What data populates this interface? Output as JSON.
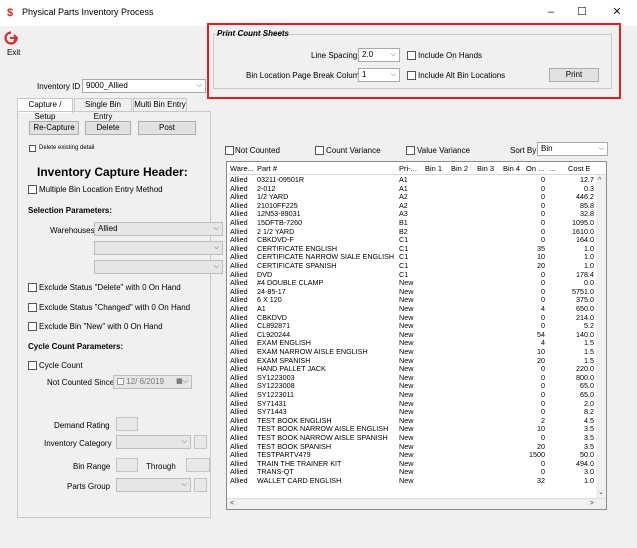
{
  "window": {
    "title": "Physical Parts Inventory Process",
    "minimize": "–",
    "maximize": "☐",
    "close": "✕"
  },
  "toolbar": {
    "exit_label": "Exit"
  },
  "inventory": {
    "label": "Inventory ID",
    "value": "9000_Allied"
  },
  "print_count_sheets": {
    "title": "Print Count Sheets",
    "line_spacing_label": "Line Spacing",
    "line_spacing_value": "2.0",
    "include_on_hands": "Include On Hands",
    "bin_break_label": "Bin Location Page Break Column",
    "bin_break_value": "1",
    "include_alt_bins": "Include Alt Bin Locations",
    "print_button": "Print"
  },
  "tabs": [
    "Capture / Setup",
    "Single Bin Entry",
    "Multi Bin Entry"
  ],
  "actions": {
    "recapture": "Re-Capture",
    "delete": "Delete",
    "post": "Post"
  },
  "capture": {
    "delete_existing": "Delete existing detail",
    "header_title": "Inventory Capture Header:",
    "multi_bin": "Multiple Bin Location Entry Method",
    "selection_params": "Selection Parameters:",
    "warehouses_label": "Warehouses",
    "warehouses_value": "Allied",
    "exclude_delete": "Exclude Status \"Delete\" with 0 On Hand",
    "exclude_changed": "Exclude Status \"Changed\" with 0 On Hand",
    "exclude_new": "Exclude Bin \"New\" with 0 On Hand",
    "cycle_params": "Cycle Count Parameters:",
    "cycle_count": "Cycle Count",
    "not_counted_since": "Not Counted Since",
    "date_value": "12/ 6/2019",
    "demand_rating": "Demand Rating",
    "inventory_category": "Inventory Category",
    "bin_range": "Bin Range",
    "through": "Through",
    "parts_group": "Parts Group"
  },
  "filters": {
    "not_counted": "Not Counted",
    "count_variance": "Count Variance",
    "value_variance": "Value Variance",
    "sort_by_label": "Sort By",
    "sort_by_value": "Bin"
  },
  "grid": {
    "columns": [
      "Ware...",
      "Part #",
      "Pri-...",
      "Bin 1",
      "Bin 2",
      "Bin 3",
      "Bin 4",
      "On ...",
      "...",
      "Cost E"
    ],
    "rows": [
      [
        "Allied",
        "03211-09501R",
        "A1",
        "0",
        "12.7"
      ],
      [
        "Allied",
        "2-012",
        "A1",
        "0",
        "0.3"
      ],
      [
        "Allied",
        "1/2 YARD",
        "A2",
        "0",
        "446.2"
      ],
      [
        "Allied",
        "21010FF225",
        "A2",
        "0",
        "85.8"
      ],
      [
        "Allied",
        "12N53-89031",
        "A3",
        "0",
        "32.8"
      ],
      [
        "Allied",
        "15DFTB-7260",
        "B1",
        "0",
        "1095.0"
      ],
      [
        "Allied",
        "2 1/2 YARD",
        "B2",
        "0",
        "1610.0"
      ],
      [
        "Allied",
        "CBKDVD-F",
        "C1",
        "0",
        "164.0"
      ],
      [
        "Allied",
        "CERTIFICATE ENGLISH",
        "C1",
        "35",
        "1.0"
      ],
      [
        "Allied",
        "CERTIFICATE NARROW SIALE ENGLISH",
        "C1",
        "10",
        "1.0"
      ],
      [
        "Allied",
        "CERTIFICATE SPANISH",
        "C1",
        "20",
        "1.0"
      ],
      [
        "Allied",
        "DVD",
        "C1",
        "0",
        "178.4"
      ],
      [
        "Allied",
        "#4 DOUBLE CLAMP",
        "New",
        "0",
        "0.0"
      ],
      [
        "Allied",
        "24-85-17",
        "New",
        "0",
        "5751.0"
      ],
      [
        "Allied",
        "6 X 120",
        "New",
        "0",
        "375.0"
      ],
      [
        "Allied",
        "A1",
        "New",
        "4",
        "650.0"
      ],
      [
        "Allied",
        "CBKDVD",
        "New",
        "0",
        "214.0"
      ],
      [
        "Allied",
        "CL892871",
        "New",
        "0",
        "5.2"
      ],
      [
        "Allied",
        "CL920244",
        "New",
        "54",
        "140.0"
      ],
      [
        "Allied",
        "EXAM ENGLISH",
        "New",
        "4",
        "1.5"
      ],
      [
        "Allied",
        "EXAM NARROW AISLE ENGLISH",
        "New",
        "10",
        "1.5"
      ],
      [
        "Allied",
        "EXAM SPANISH",
        "New",
        "20",
        "1.5"
      ],
      [
        "Allied",
        "HAND PALLET JACK",
        "New",
        "0",
        "220.0"
      ],
      [
        "Allied",
        "SY1223003",
        "New",
        "0",
        "800.0"
      ],
      [
        "Allied",
        "SY1223008",
        "New",
        "0",
        "65.0"
      ],
      [
        "Allied",
        "SY1223011",
        "New",
        "0",
        "65.0"
      ],
      [
        "Allied",
        "SY71431",
        "New",
        "0",
        "2.0"
      ],
      [
        "Allied",
        "SY71443",
        "New",
        "0",
        "8.2"
      ],
      [
        "Allied",
        "TEST BOOK ENGLISH",
        "New",
        "2",
        "4.5"
      ],
      [
        "Allied",
        "TEST BOOK NARROW AISLE ENGLISH",
        "New",
        "10",
        "3.5"
      ],
      [
        "Allied",
        "TEST BOOK NARROW AISLE SPANISH",
        "New",
        "0",
        "3.5"
      ],
      [
        "Allied",
        "TEST BOOK SPANISH",
        "New",
        "20",
        "3.5"
      ],
      [
        "Allied",
        "TESTPARTV479",
        "New",
        "1500",
        "50.0"
      ],
      [
        "Allied",
        "TRAIN THE TRAINER KIT",
        "New",
        "0",
        "494.0"
      ],
      [
        "Allied",
        "TRANS-QT",
        "New",
        "0",
        "3.0"
      ],
      [
        "Allied",
        "WALLET CARD ENGLISH",
        "New",
        "32",
        "1.0"
      ]
    ]
  }
}
